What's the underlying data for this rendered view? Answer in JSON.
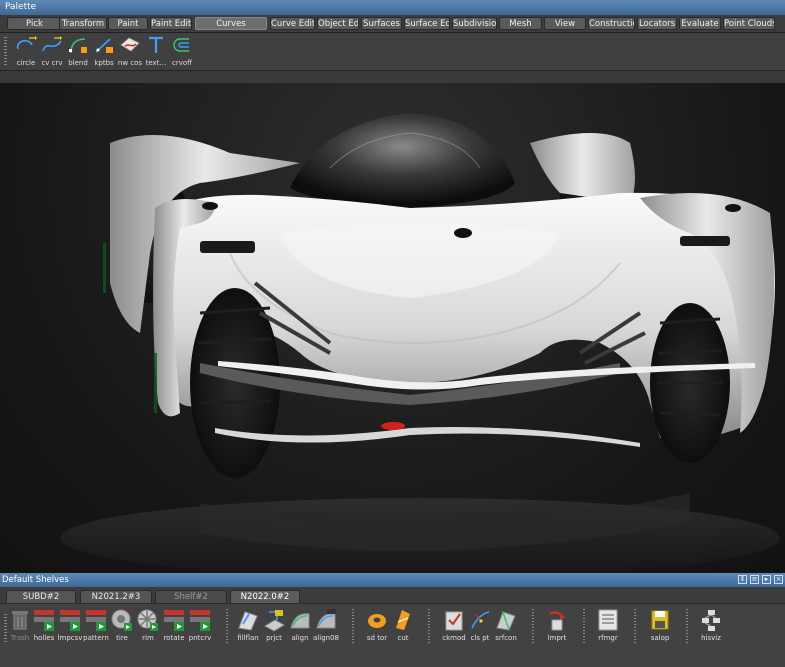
{
  "palette": {
    "title": "Palette",
    "tabs": [
      "Pick",
      "Transform",
      "Paint",
      "Paint Edit",
      "Curves",
      "Curve Edit",
      "Object Edit",
      "Surfaces",
      "Surface Edit",
      "Subdivision",
      "Mesh",
      "View",
      "Construction",
      "Locators",
      "Evaluate",
      "Point Clouds"
    ],
    "active_tab": "Curves",
    "tools": [
      {
        "label": "circle",
        "icon": "circle-curve-icon"
      },
      {
        "label": "cv crv",
        "icon": "cv-curve-icon"
      },
      {
        "label": "blend",
        "icon": "blend-curve-icon"
      },
      {
        "label": "kptbs",
        "icon": "keypoint-curve-icon"
      },
      {
        "label": "nw cos",
        "icon": "new-cos-icon"
      },
      {
        "label": "text…",
        "icon": "text-curve-icon"
      },
      {
        "label": "crvoff",
        "icon": "curve-offset-icon"
      }
    ]
  },
  "shelves": {
    "title": "Default Shelves",
    "tabs": [
      "SUBD#2",
      "N2021.2#3",
      "Shelf#2",
      "N2022.0#2"
    ],
    "active_tab": "N2022.0#2",
    "dim_tab": "Shelf#2",
    "tools": [
      {
        "label": "Trash",
        "icon": "trash-icon",
        "dim": true
      },
      {
        "label": "holles",
        "icon": "holes-macro-icon"
      },
      {
        "label": "lmpcsv",
        "icon": "import-csv-macro-icon"
      },
      {
        "label": "pattern",
        "icon": "pattern-macro-icon"
      },
      {
        "label": "tire",
        "icon": "tire-macro-icon"
      },
      {
        "label": "rim",
        "icon": "rim-macro-icon"
      },
      {
        "label": "rotate",
        "icon": "rotate-macro-icon"
      },
      {
        "label": "pntcrv",
        "icon": "point-curve-macro-icon"
      },
      {
        "label": "fillflan",
        "icon": "fillet-flange-icon"
      },
      {
        "label": "prjct",
        "icon": "project-icon"
      },
      {
        "label": "align",
        "icon": "align-icon"
      },
      {
        "label": "align08",
        "icon": "align08-icon"
      },
      {
        "label": "sd tor",
        "icon": "torus-icon"
      },
      {
        "label": "cut",
        "icon": "cut-icon"
      },
      {
        "label": "ckmod",
        "icon": "check-model-icon"
      },
      {
        "label": "cls pt",
        "icon": "closest-point-icon"
      },
      {
        "label": "srfcon",
        "icon": "surface-continuity-icon"
      },
      {
        "label": "lmprt",
        "icon": "import-icon"
      },
      {
        "label": "rfmgr",
        "icon": "reference-manager-icon"
      },
      {
        "label": "salop",
        "icon": "save-all-icon"
      },
      {
        "label": "hisviz",
        "icon": "history-visualizer-icon"
      }
    ]
  },
  "colors": {
    "titlebar": "#4a77a6",
    "car_body": "#e6e6e6",
    "accent_red": "#d0241b",
    "macro_red": "#c8332c",
    "macro_green": "#1e9a3a"
  }
}
